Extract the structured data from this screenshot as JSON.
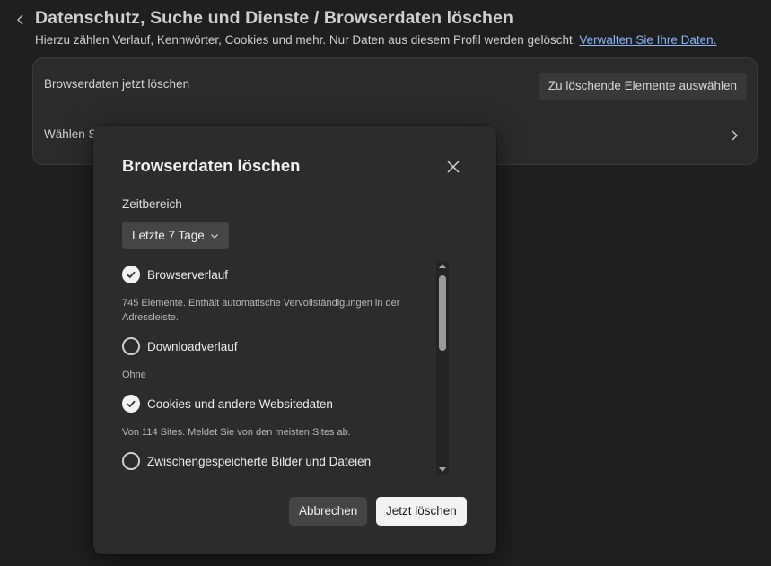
{
  "header": {
    "title": "Datenschutz, Suche und Dienste / Browserdaten löschen",
    "subtitle": "Hierzu zählen Verlauf, Kennwörter, Cookies und mehr. Nur Daten aus diesem Profil werden gelöscht.",
    "manage_link": "Verwalten Sie Ihre Daten."
  },
  "settings_card": {
    "row1_label": "Browserdaten jetzt löschen",
    "row1_button": "Zu löschende Elemente auswählen",
    "row2_label": "Wählen S"
  },
  "dialog": {
    "title": "Browserdaten löschen",
    "time_range_label": "Zeitbereich",
    "time_range_value": "Letzte 7 Tage",
    "options": [
      {
        "label": "Browserverlauf",
        "checked": true,
        "description": "745 Elemente. Enthält automatische Vervollständigungen in der Adressleiste."
      },
      {
        "label": "Downloadverlauf",
        "checked": false,
        "description": "Ohne"
      },
      {
        "label": "Cookies und andere Websitedaten",
        "checked": true,
        "description": "Von 114 Sites. Meldet Sie von den meisten Sites ab."
      },
      {
        "label": "Zwischengespeicherte Bilder und Dateien",
        "checked": false,
        "description": ""
      }
    ],
    "cancel_label": "Abbrechen",
    "confirm_label": "Jetzt löschen"
  },
  "colors": {
    "page_background": "#1f1f1f",
    "dialog_background": "#2c2c2c",
    "link": "#8ab4f8",
    "primary_button": "#f3f3f3"
  },
  "icons": {
    "back": "chevron-left-icon",
    "row_chevron": "chevron-right-icon",
    "close": "close-icon",
    "dropdown": "chevron-down-icon",
    "checked": "checkmark-icon"
  }
}
